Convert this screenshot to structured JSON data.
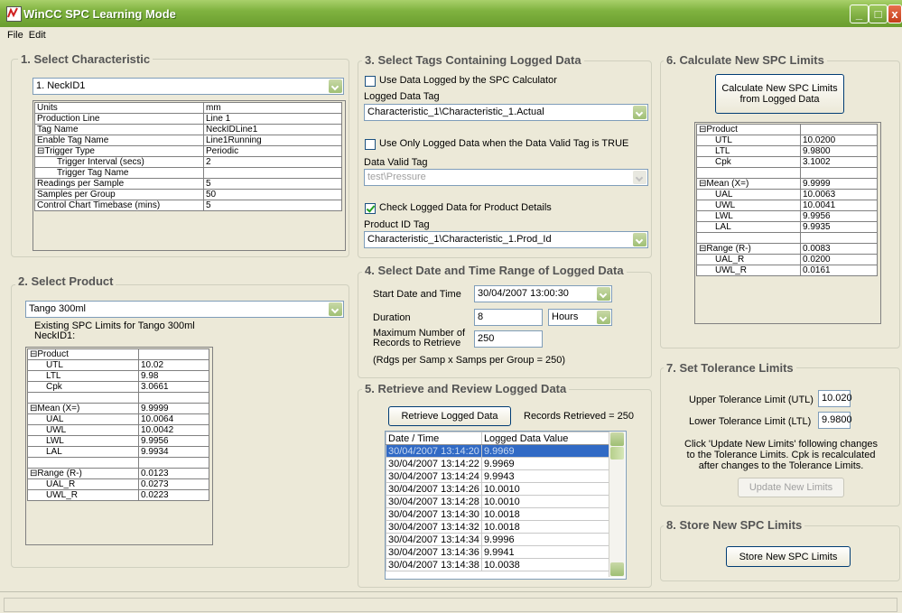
{
  "window": {
    "title": "WinCC SPC Learning Mode"
  },
  "menu": [
    "File",
    "Edit"
  ],
  "s1": {
    "title": "1. Select Characteristic",
    "characteristic": "1. NeckID1",
    "rows": [
      {
        "label": "Units",
        "value": "mm"
      },
      {
        "label": "Production Line",
        "value": "Line 1"
      },
      {
        "label": "Tag Name",
        "value": "NeckIDLine1"
      },
      {
        "label": "Enable Tag Name",
        "value": "Line1Running"
      },
      {
        "label": "⊟Trigger Type",
        "value": "Periodic"
      },
      {
        "label": "Trigger Interval (secs)",
        "value": "2"
      },
      {
        "label": "Trigger Tag Name",
        "value": ""
      },
      {
        "label": "Readings per Sample",
        "value": "5"
      },
      {
        "label": "Samples per Group",
        "value": "50"
      },
      {
        "label": "Control Chart Timebase (mins)",
        "value": "5"
      }
    ]
  },
  "s2": {
    "title": "2. Select Product",
    "product": "Tango 300ml",
    "existing_text": "Existing SPC Limits for Tango 300ml NeckID1:",
    "rows": [
      {
        "label": "⊟Product",
        "value": ""
      },
      {
        "label": "UTL",
        "value": "10.02"
      },
      {
        "label": "LTL",
        "value": "9.98"
      },
      {
        "label": "Cpk",
        "value": "3.0661"
      },
      {
        "label": "",
        "value": ""
      },
      {
        "label": "⊟Mean (X=)",
        "value": "9.9999"
      },
      {
        "label": "UAL",
        "value": "10.0064"
      },
      {
        "label": "UWL",
        "value": "10.0042"
      },
      {
        "label": "LWL",
        "value": "9.9956"
      },
      {
        "label": "LAL",
        "value": "9.9934"
      },
      {
        "label": "",
        "value": ""
      },
      {
        "label": "⊟Range (R-)",
        "value": "0.0123"
      },
      {
        "label": "UAL_R",
        "value": "0.0273"
      },
      {
        "label": "UWL_R",
        "value": "0.0223"
      }
    ]
  },
  "s3": {
    "title": "3. Select Tags Containing Logged Data",
    "use_spc_label": "Use Data Logged by the SPC Calculator",
    "logged_tag_label": "Logged Data Tag",
    "logged_tag_value": "Characteristic_1\\Characteristic_1.Actual",
    "use_valid_label": "Use Only Logged Data when the Data Valid Tag is TRUE",
    "valid_tag_label": "Data Valid Tag",
    "valid_tag_value": "test\\Pressure",
    "check_product_label": "Check Logged Data for Product Details",
    "product_id_label": "Product ID Tag",
    "product_id_value": "Characteristic_1\\Characteristic_1.Prod_Id"
  },
  "s4": {
    "title": "4. Select Date and Time Range of Logged Data",
    "start_label": "Start Date and Time",
    "start_value": "30/04/2007 13:00:30",
    "duration_label": "Duration",
    "duration_value": "8",
    "duration_unit": "Hours",
    "max_label_1": "Maximum Number of",
    "max_label_2": "Records to Retrieve",
    "max_value": "250",
    "note": "(Rdgs per Samp x Samps per Group = 250)"
  },
  "s5": {
    "title": "5. Retrieve and Review Logged Data",
    "retrieve_label": "Retrieve Logged Data",
    "records_text": "Records Retrieved = 250",
    "col_date": "Date / Time",
    "col_value": "Logged Data Value",
    "rows": [
      {
        "date": "30/04/2007 13:14:20",
        "value": "9.9969"
      },
      {
        "date": "30/04/2007 13:14:22",
        "value": "9.9969"
      },
      {
        "date": "30/04/2007 13:14:24",
        "value": "9.9943"
      },
      {
        "date": "30/04/2007 13:14:26",
        "value": "10.0010"
      },
      {
        "date": "30/04/2007 13:14:28",
        "value": "10.0010"
      },
      {
        "date": "30/04/2007 13:14:30",
        "value": "10.0018"
      },
      {
        "date": "30/04/2007 13:14:32",
        "value": "10.0018"
      },
      {
        "date": "30/04/2007 13:14:34",
        "value": "9.9996"
      },
      {
        "date": "30/04/2007 13:14:36",
        "value": "9.9941"
      },
      {
        "date": "30/04/2007 13:14:38",
        "value": "10.0038"
      }
    ]
  },
  "s6": {
    "title": "6. Calculate New SPC Limits",
    "calc_line1": "Calculate New SPC Limits",
    "calc_line2": "from Logged Data",
    "rows": [
      {
        "label": "⊟Product",
        "value": ""
      },
      {
        "label": "UTL",
        "value": "10.0200"
      },
      {
        "label": "LTL",
        "value": "9.9800"
      },
      {
        "label": "Cpk",
        "value": "3.1002"
      },
      {
        "label": "",
        "value": ""
      },
      {
        "label": "⊟Mean (X=)",
        "value": "9.9999"
      },
      {
        "label": "UAL",
        "value": "10.0063"
      },
      {
        "label": "UWL",
        "value": "10.0041"
      },
      {
        "label": "LWL",
        "value": "9.9956"
      },
      {
        "label": "LAL",
        "value": "9.9935"
      },
      {
        "label": "",
        "value": ""
      },
      {
        "label": "⊟Range (R-)",
        "value": "0.0083"
      },
      {
        "label": "UAL_R",
        "value": "0.0200"
      },
      {
        "label": "UWL_R",
        "value": "0.0161"
      }
    ]
  },
  "s7": {
    "title": "7. Set Tolerance Limits",
    "utl_label": "Upper Tolerance Limit (UTL)",
    "utl_value": "10.020",
    "ltl_label": "Lower Tolerance Limit (LTL)",
    "ltl_value": "9.9800",
    "note1": "Click 'Update New Limits' following changes",
    "note2": "to the Tolerance Limits. Cpk is recalculated",
    "note3": "after changes to the Tolerance Limits.",
    "update_label": "Update New Limits"
  },
  "s8": {
    "title": "8. Store New SPC Limits",
    "store_label": "Store New SPC Limits"
  }
}
